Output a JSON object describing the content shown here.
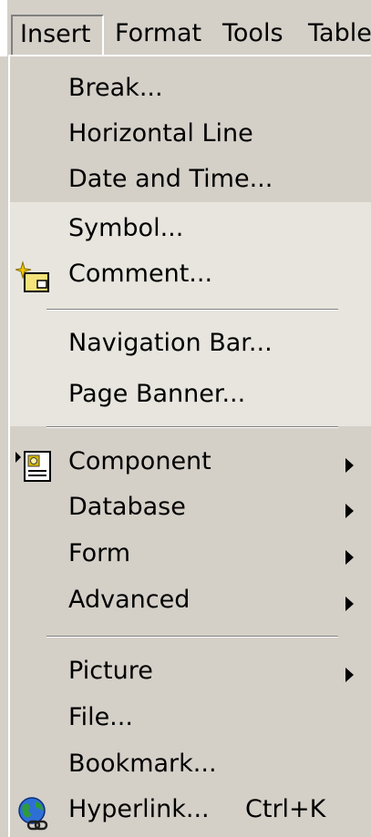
{
  "menubar": {
    "items": [
      {
        "label": "Insert"
      },
      {
        "label": "Format"
      },
      {
        "label": "Tools"
      },
      {
        "label": "Table"
      }
    ]
  },
  "insert_menu": {
    "items": [
      {
        "label": "Break..."
      },
      {
        "label": "Horizontal Line"
      },
      {
        "label": "Date and Time..."
      },
      {
        "label": "Symbol..."
      },
      {
        "label": "Comment...",
        "icon": "comment-icon"
      },
      {
        "label": "Navigation Bar..."
      },
      {
        "label": "Page Banner..."
      },
      {
        "label": "Component",
        "icon": "component-icon",
        "submenu": true
      },
      {
        "label": "Database",
        "submenu": true
      },
      {
        "label": "Form",
        "submenu": true
      },
      {
        "label": "Advanced",
        "submenu": true
      },
      {
        "label": "Picture",
        "submenu": true
      },
      {
        "label": "File..."
      },
      {
        "label": "Bookmark..."
      },
      {
        "label": "Hyperlink...",
        "shortcut": "Ctrl+K",
        "icon": "hyperlink-globe-icon"
      }
    ]
  }
}
